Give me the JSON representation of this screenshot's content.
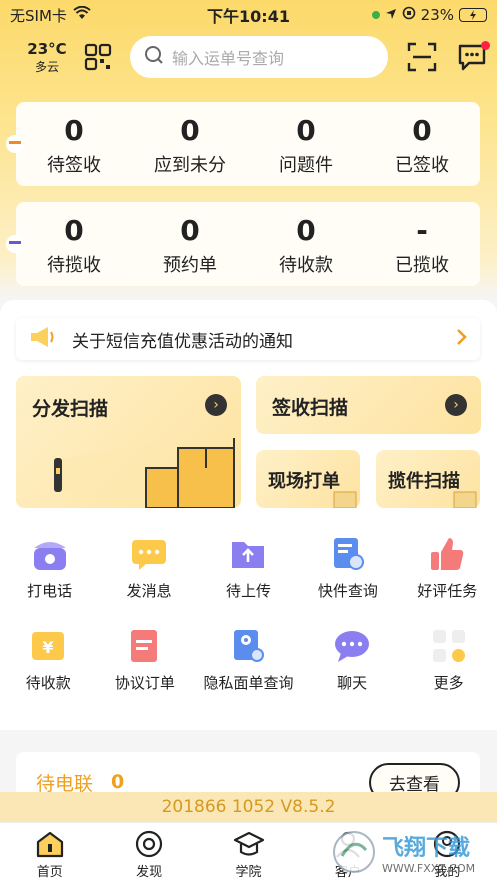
{
  "status_bar": {
    "carrier": "无SIM卡",
    "time": "下午10:41",
    "battery": "23%"
  },
  "header": {
    "weather": {
      "temp": "23°C",
      "condition": "多云"
    },
    "search_placeholder": "输入运单号查询"
  },
  "sign_stats": [
    {
      "value": "0",
      "label": "待签收"
    },
    {
      "value": "0",
      "label": "应到未分"
    },
    {
      "value": "0",
      "label": "问题件"
    },
    {
      "value": "0",
      "label": "已签收"
    }
  ],
  "pickup_stats": [
    {
      "value": "0",
      "label": "待揽收"
    },
    {
      "value": "0",
      "label": "预约单"
    },
    {
      "value": "0",
      "label": "待收款"
    },
    {
      "value": "-",
      "label": "已揽收"
    }
  ],
  "notice": {
    "text": "关于短信充值优惠活动的通知"
  },
  "actions": {
    "dispatch_scan": "分发扫描",
    "sign_scan": "签收扫描",
    "onsite_print": "现场打单",
    "pickup_scan": "揽件扫描"
  },
  "grid_row1": [
    {
      "label": "打电话",
      "icon": "phone-icon"
    },
    {
      "label": "发消息",
      "icon": "message-icon"
    },
    {
      "label": "待上传",
      "icon": "upload-folder-icon"
    },
    {
      "label": "快件查询",
      "icon": "package-search-icon"
    },
    {
      "label": "好评任务",
      "icon": "thumbs-up-icon"
    }
  ],
  "grid_row2": [
    {
      "label": "待收款",
      "icon": "yuan-icon"
    },
    {
      "label": "协议订单",
      "icon": "contract-icon"
    },
    {
      "label": "隐私面单查询",
      "icon": "privacy-search-icon"
    },
    {
      "label": "聊天",
      "icon": "chat-icon"
    },
    {
      "label": "更多",
      "icon": "more-icon"
    }
  ],
  "pending_contact": {
    "label": "待电联",
    "count": "0",
    "button": "去查看"
  },
  "version": "201866  1052  V8.5.2",
  "tabs": [
    {
      "label": "首页",
      "icon": "home-icon"
    },
    {
      "label": "发现",
      "icon": "discover-icon"
    },
    {
      "label": "学院",
      "icon": "academy-icon"
    },
    {
      "label": "客户",
      "icon": "customer-icon"
    },
    {
      "label": "我的",
      "icon": "profile-icon"
    }
  ],
  "watermark": {
    "text": "飞翔下载",
    "url": "WWW.FXXZ.COM"
  },
  "colors": {
    "accent": "#fcd96a",
    "orange_text": "#f0a020"
  }
}
